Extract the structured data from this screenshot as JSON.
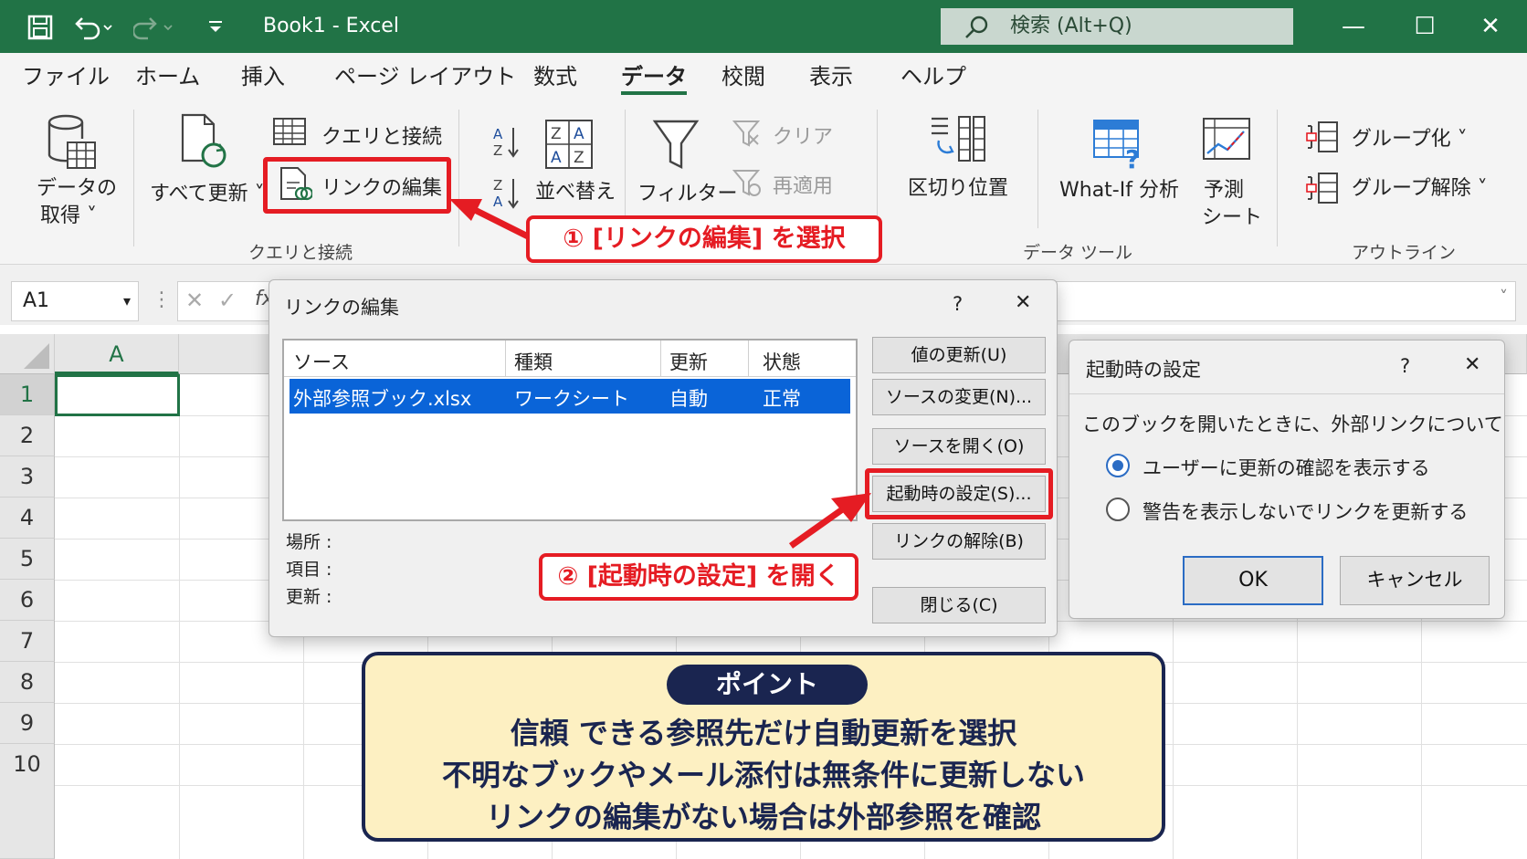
{
  "titlebar": {
    "title": "Book1  -  Excel",
    "search": "検索 (Alt+Q)",
    "minimize": "—",
    "maximize": "☐",
    "close": "✕"
  },
  "tabs": [
    "ファイル",
    "ホーム",
    "挿入",
    "ページ レイアウト",
    "数式",
    "データ",
    "校閲",
    "表示",
    "ヘルプ"
  ],
  "active_tab": "データ",
  "ribbon": {
    "get_data_1": "データの",
    "get_data_2": "取得",
    "refresh_all": "すべて更新",
    "queries_connections": "クエリと接続",
    "edit_links": "リンクの編集",
    "group_queries": "クエリと接続",
    "sort": "並べ替え",
    "filter": "フィルター",
    "clear": "クリア",
    "reapply": "再適用",
    "text_to_columns": "区切り位置",
    "what_if": "What-If 分析",
    "forecast_1": "予測",
    "forecast_2": "シート",
    "group_data_tools": "データ ツール",
    "group": "グループ化",
    "ungroup": "グループ解除",
    "group_outline": "アウトライン"
  },
  "formula_bar": {
    "name_box": "A1",
    "fx": "fx"
  },
  "sheet": {
    "columns": [
      "A"
    ],
    "rows": [
      "1",
      "2",
      "3",
      "4",
      "5",
      "6",
      "7",
      "8",
      "9",
      "10"
    ]
  },
  "edit_links_dialog": {
    "title": "リンクの編集",
    "help": "?",
    "close": "✕",
    "headers": [
      "ソース",
      "種類",
      "更新",
      "状態"
    ],
    "row": [
      "外部参照ブック.xlsx",
      "ワークシート",
      "自動",
      "正常"
    ],
    "location_label": "場所 :",
    "item_label": "項目 :",
    "update_label": "更新 :",
    "buttons": {
      "update_values": "値の更新(U)",
      "change_source": "ソースの変更(N)...",
      "open_source": "ソースを開く(O)",
      "startup_prompt": "起動時の設定(S)...",
      "break_link": "リンクの解除(B)",
      "close": "閉じる(C)"
    }
  },
  "startup_dialog": {
    "title": "起動時の設定",
    "help": "?",
    "close": "✕",
    "prompt": "このブックを開いたときに、外部リンクについて",
    "option1": "ユーザーに更新の確認を表示する",
    "option2": "警告を表示しないでリンクを更新する",
    "selected": "option1",
    "ok": "OK",
    "cancel": "キャンセル"
  },
  "callouts": {
    "step1": "① [リンクの編集] を選択",
    "step2": "② [起動時の設定] を開く"
  },
  "point": {
    "badge": "ポイント",
    "line1": "信頼 できる参照先だけ自動更新を選択",
    "line2": "不明なブックやメール添付は無条件に更新しない",
    "line3": "リンクの編集がない場合は外部参照を確認"
  },
  "colors": {
    "excel_green": "#217346",
    "callout_red": "#e51c23",
    "selection_blue": "#0a64d8",
    "point_navy": "#1a2550",
    "point_bg": "#fdf0c2"
  }
}
